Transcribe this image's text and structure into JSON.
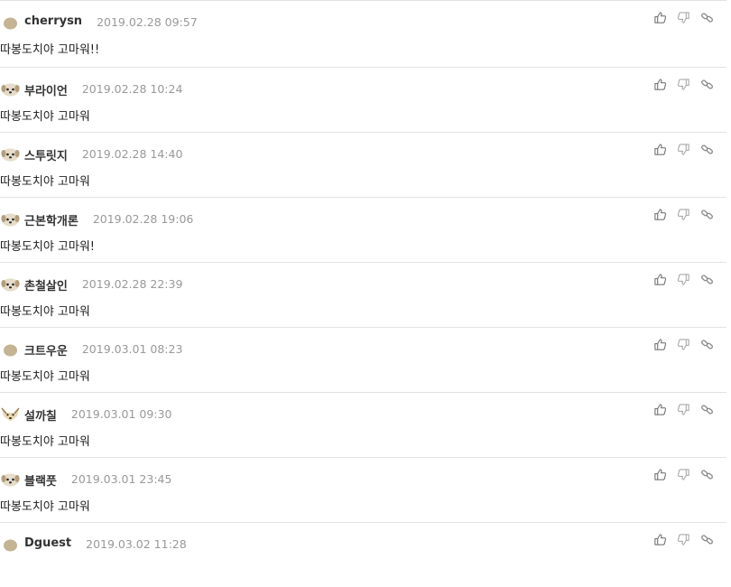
{
  "comments": [
    {
      "author": "cherrysn",
      "date": "2019.02.28 09:57",
      "text": "따봉도치야 고마워!!",
      "avatar": "blob-avatar"
    },
    {
      "author": "부라이언",
      "date": "2019.02.28 10:24",
      "text": "따봉도치야 고마워",
      "avatar": "dog-avatar"
    },
    {
      "author": "스투릿지",
      "date": "2019.02.28 14:40",
      "text": "따봉도치야 고마워",
      "avatar": "dog-avatar"
    },
    {
      "author": "근본학개론",
      "date": "2019.02.28 19:06",
      "text": "따봉도치야 고마워!",
      "avatar": "dog-avatar"
    },
    {
      "author": "촌철살인",
      "date": "2019.02.28 22:39",
      "text": "따봉도치야 고마워",
      "avatar": "dog-avatar"
    },
    {
      "author": "크트우운",
      "date": "2019.03.01 08:23",
      "text": "따봉도치야 고마워",
      "avatar": "blob-avatar"
    },
    {
      "author": "설까칠",
      "date": "2019.03.01 09:30",
      "text": "따봉도치야 고마워",
      "avatar": "fox-avatar"
    },
    {
      "author": "블랙풋",
      "date": "2019.03.01 23:45",
      "text": "따봉도치야 고마워",
      "avatar": "dog-avatar"
    },
    {
      "author": "Dguest",
      "date": "2019.03.02 11:28",
      "text": "",
      "avatar": "blob-avatar"
    }
  ],
  "icons": {
    "like": "thumbs-up-icon",
    "dislike": "thumbs-down-icon",
    "link": "link-icon"
  },
  "colors": {
    "date": "#999999",
    "divider": "#e3e3e3",
    "avatar": "#c9b99a"
  }
}
